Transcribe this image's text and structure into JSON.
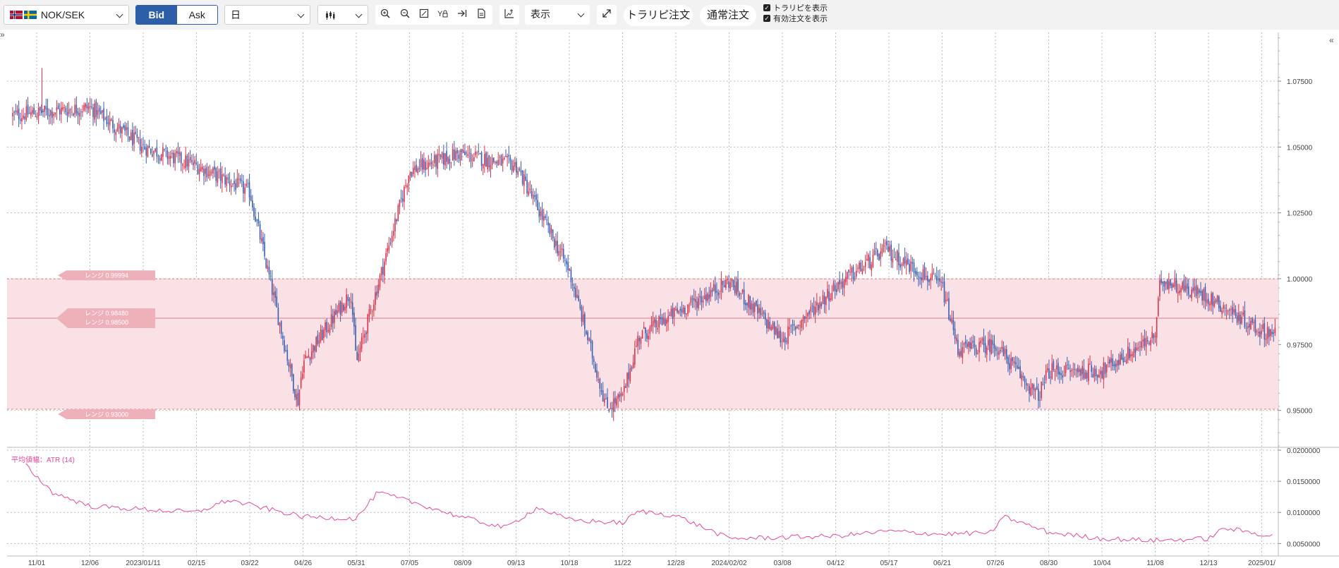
{
  "toolbar": {
    "pair_label": "NOK/SEK",
    "bid_label": "Bid",
    "ask_label": "Ask",
    "period_label": "日",
    "display_label": "表示",
    "trailing_order_label": "トラリピ注文",
    "normal_order_label": "通常注文",
    "show_trailing_label": "トラリピを表示",
    "show_active_orders_label": "有効注文を表示",
    "show_trailing_checked": true,
    "show_active_orders_checked": true,
    "collapse_left_icon": "double-chevron-right-icon",
    "collapse_right_icon": "double-chevron-left-icon"
  },
  "colors": {
    "up_candle": "#d9334d",
    "down_candle": "#3a5fb0",
    "range_fill": "#f9e1e5",
    "range_line": "#e07d8f",
    "atr_line": "#e8489a",
    "label_tag": "#eeb1ba"
  },
  "chart_data": [
    {
      "type": "candlestick",
      "pair": "NOK/SEK",
      "timeframe": "日",
      "x_tick_labels": [
        "11/01",
        "12/06",
        "2023/01/11",
        "02/15",
        "03/22",
        "04/26",
        "05/31",
        "07/05",
        "08/09",
        "09/13",
        "10/18",
        "11/22",
        "12/28",
        "2024/02/02",
        "03/08",
        "04/12",
        "05/17",
        "06/21",
        "07/26",
        "08/30",
        "10/04",
        "11/08",
        "12/13",
        "2025/01/"
      ],
      "y_tick_labels": [
        "1.07500",
        "1.05000",
        "1.02500",
        "1.00000",
        "0.97500",
        "0.95000"
      ],
      "ylim": [
        0.9365,
        1.0935
      ],
      "grid": true,
      "price_path": {
        "x_ticks": [
          0,
          1,
          2,
          3,
          4,
          5,
          6,
          7,
          8,
          9,
          10,
          11,
          12,
          13,
          14,
          15,
          16,
          17,
          18,
          19,
          20,
          21,
          22,
          23
        ],
        "close": [
          1.063,
          1.065,
          1.05,
          1.043,
          1.033,
          0.968,
          0.968,
          1.041,
          1.047,
          1.043,
          1.003,
          0.955,
          0.987,
          0.999,
          0.977,
          0.997,
          1.01,
          0.997,
          0.975,
          0.965,
          0.965,
          0.978,
          0.993,
          0.98
        ],
        "notable": [
          {
            "label": "start",
            "x": -0.45,
            "close": 1.062
          },
          {
            "label": "spike-high",
            "x": 0.1,
            "high": 1.08
          },
          {
            "label": "low",
            "x": 4.9,
            "close": 0.953
          },
          {
            "label": "mid-high",
            "x": 5.9,
            "close": 0.995
          },
          {
            "label": "peak",
            "x": 8.0,
            "close": 1.048
          },
          {
            "label": "low",
            "x": 10.7,
            "close": 0.951
          },
          {
            "label": "rebound",
            "x": 11.3,
            "close": 0.978
          },
          {
            "label": "peak",
            "x": 16.0,
            "close": 1.012
          },
          {
            "label": "drop",
            "x": 17.3,
            "close": 0.973
          },
          {
            "label": "bottom",
            "x": 18.8,
            "close": 0.955
          },
          {
            "label": "high",
            "x": 21.1,
            "close": 1.0
          },
          {
            "label": "end",
            "x": 23.2,
            "close": 0.98
          }
        ]
      },
      "range_band": {
        "upper": 0.99994,
        "lower": 0.93,
        "mid_lines": [
          0.9848,
          0.985
        ],
        "labels": [
          "レンジ 0.99994",
          "レンジ 0.98480",
          "レンジ 0.98500",
          "レンジ 0.93000"
        ]
      }
    },
    {
      "type": "line",
      "indicator_label": "平均値幅：ATR (14)",
      "y_tick_labels": [
        "0.0200000",
        "0.0150000",
        "0.0100000",
        "0.0050000"
      ],
      "ylim": [
        0.003,
        0.02
      ],
      "x_ticks": [
        -0.2,
        0.3,
        1.0,
        2.0,
        3.0,
        3.6,
        4.0,
        5.0,
        6.0,
        6.4,
        7.0,
        8.0,
        8.8,
        9.4,
        10.0,
        11.0,
        11.3,
        12.0,
        13.0,
        14.0,
        15.0,
        16.0,
        17.0,
        18.0,
        18.1,
        19.0,
        20.0,
        21.0,
        22.0,
        22.3,
        23.2
      ],
      "values": [
        0.0175,
        0.0132,
        0.011,
        0.0105,
        0.01,
        0.012,
        0.0112,
        0.0093,
        0.009,
        0.0132,
        0.0118,
        0.0092,
        0.0075,
        0.0108,
        0.0088,
        0.0083,
        0.0102,
        0.0095,
        0.0058,
        0.006,
        0.0062,
        0.007,
        0.0065,
        0.0068,
        0.0095,
        0.0068,
        0.0058,
        0.0055,
        0.0058,
        0.0075,
        0.0062
      ]
    }
  ]
}
